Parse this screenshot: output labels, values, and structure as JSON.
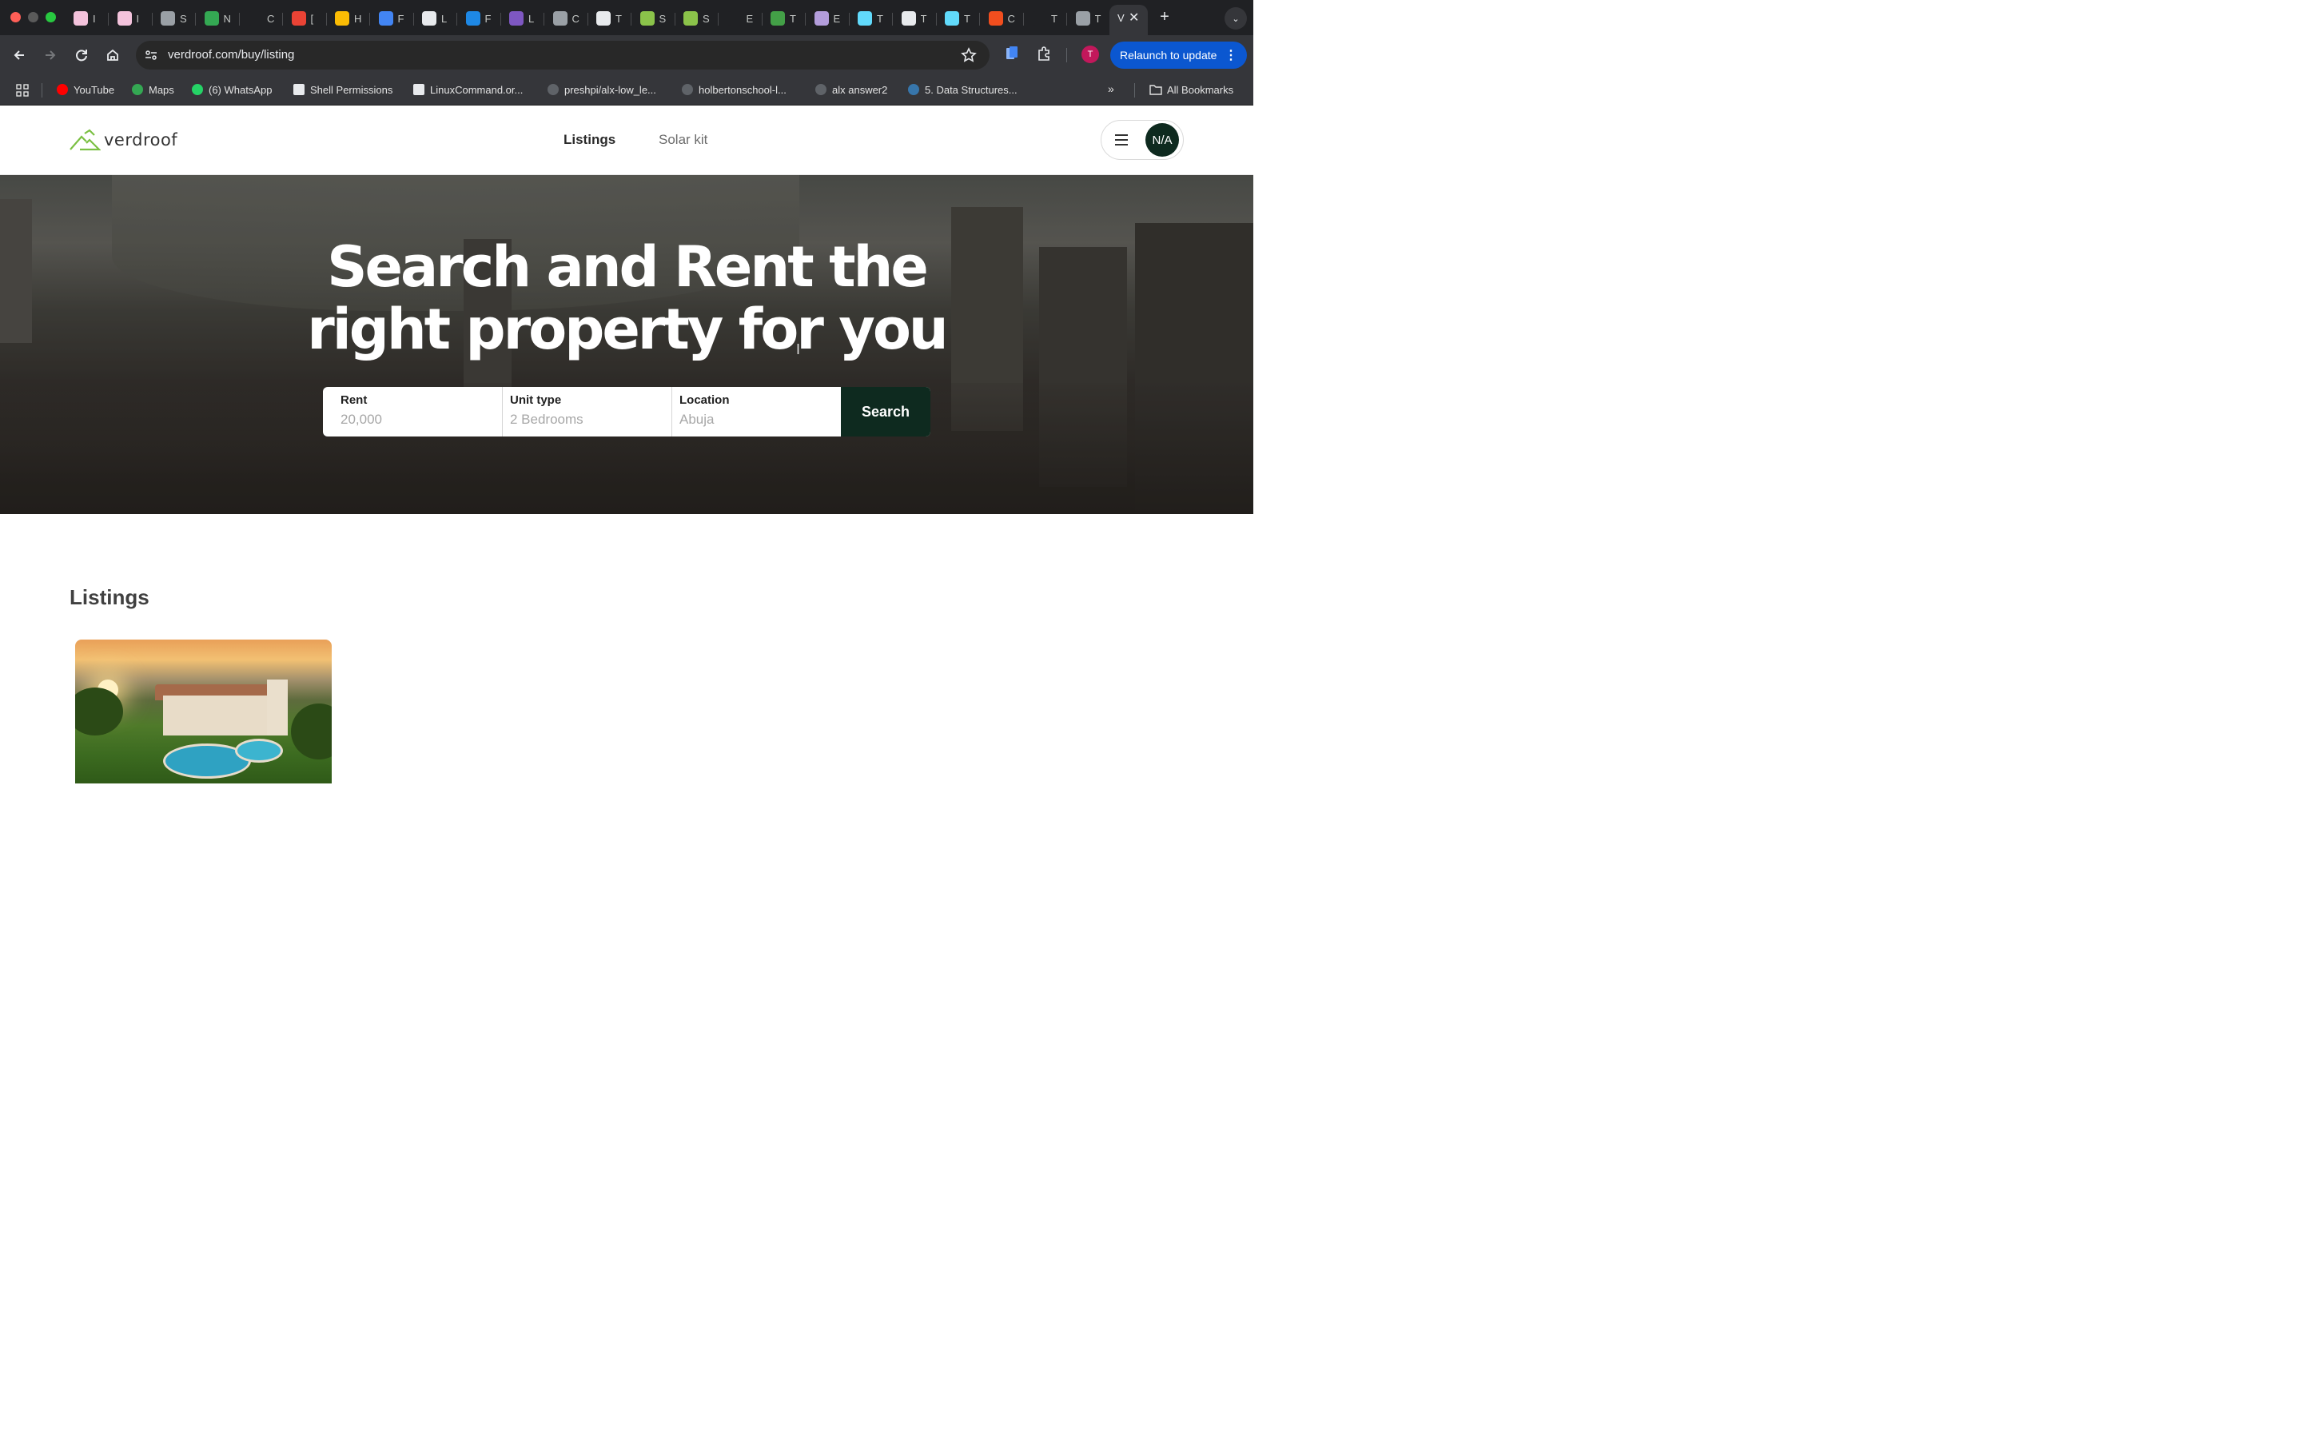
{
  "browser": {
    "tabs": [
      {
        "label": "I",
        "color": "#f4c3dc"
      },
      {
        "label": "I",
        "color": "#f4c3dc"
      },
      {
        "label": "S",
        "color": "#9aa0a6"
      },
      {
        "label": "N",
        "color": "#34a853"
      },
      {
        "label": "C",
        "color": "#202124"
      },
      {
        "label": "[",
        "color": "#ea4335"
      },
      {
        "label": "H",
        "color": "#fbbc04"
      },
      {
        "label": "F",
        "color": "#4285f4"
      },
      {
        "label": "L",
        "color": "#e8eaed"
      },
      {
        "label": "F",
        "color": "#1e88e5"
      },
      {
        "label": "L",
        "color": "#7e57c2"
      },
      {
        "label": "C",
        "color": "#9aa0a6"
      },
      {
        "label": "T",
        "color": "#e8eaed"
      },
      {
        "label": "S",
        "color": "#8bc34a"
      },
      {
        "label": "S",
        "color": "#8bc34a"
      },
      {
        "label": "E",
        "color": "#202124"
      },
      {
        "label": "T",
        "color": "#43a047"
      },
      {
        "label": "E",
        "color": "#b39ddb"
      },
      {
        "label": "T",
        "color": "#61dafb"
      },
      {
        "label": "T",
        "color": "#e8eaed"
      },
      {
        "label": "T",
        "color": "#61dafb"
      },
      {
        "label": "C",
        "color": "#f24e1e"
      },
      {
        "label": "T",
        "color": "#202124"
      },
      {
        "label": "T",
        "color": "#9aa0a6"
      }
    ],
    "active_tab_label": "V",
    "url": "verdroof.com/buy/listing",
    "relaunch_label": "Relaunch to update",
    "profile_initial": "T",
    "bookmarks": [
      {
        "label": "YouTube",
        "icon": "youtube-icon",
        "color": "#ff0000"
      },
      {
        "label": "Maps",
        "icon": "maps-icon",
        "color": "#34a853"
      },
      {
        "label": "(6) WhatsApp",
        "icon": "whatsapp-icon",
        "color": "#25d366"
      },
      {
        "label": "Shell Permissions",
        "icon": "page-icon",
        "color": "#e8eaed"
      },
      {
        "label": "LinuxCommand.or...",
        "icon": "page-icon",
        "color": "#e8eaed"
      },
      {
        "label": "preshpi/alx-low_le...",
        "icon": "github-icon",
        "color": "#5f6368"
      },
      {
        "label": "holbertonschool-l...",
        "icon": "github-icon",
        "color": "#5f6368"
      },
      {
        "label": "alx answer2",
        "icon": "github-icon",
        "color": "#5f6368"
      },
      {
        "label": "5. Data Structures...",
        "icon": "python-icon",
        "color": "#3776ab"
      }
    ],
    "all_bookmarks_label": "All Bookmarks"
  },
  "site": {
    "logo_text": "verdroof",
    "brand_color": "#0e2a1f",
    "logo_color": "#7bc043",
    "nav": {
      "listings": "Listings",
      "solar_kit": "Solar kit"
    },
    "avatar_text": "N/A"
  },
  "hero": {
    "title_line1": "Search and Rent the",
    "title_line2": "right property for you",
    "search": {
      "rent_label": "Rent",
      "rent_placeholder": "20,000",
      "unit_label": "Unit type",
      "unit_placeholder": "2 Bedrooms",
      "location_label": "Location",
      "location_placeholder": "Abuja",
      "button_label": "Search"
    }
  },
  "listings": {
    "title": "Listings"
  }
}
